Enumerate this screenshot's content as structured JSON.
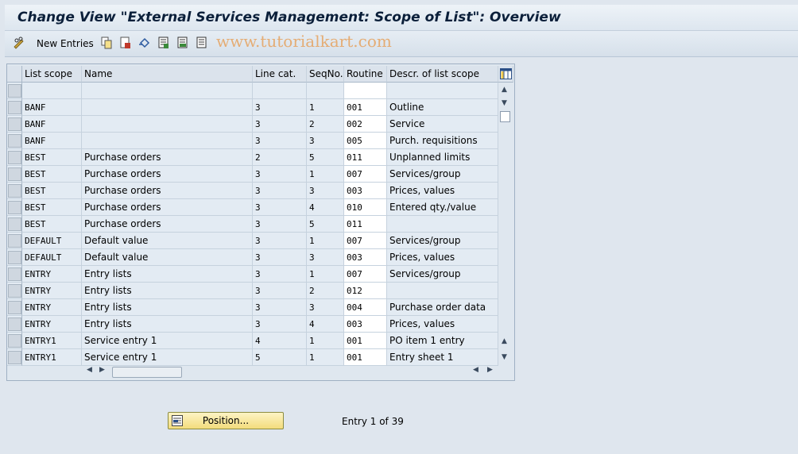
{
  "window": {
    "title": "Change View \"External Services Management: Scope of List\": Overview"
  },
  "toolbar": {
    "new_entries_label": "New Entries",
    "watermark": "www.tutorialkart.com",
    "icons": [
      "pencil-glasses-icon",
      "copy-icon",
      "delete-icon",
      "undo-icon",
      "select-all-icon",
      "select-block-icon",
      "deselect-all-icon"
    ]
  },
  "table": {
    "headers": {
      "list_scope": "List scope",
      "name": "Name",
      "line_cat": "Line cat.",
      "seq_no": "SeqNo.",
      "routine": "Routine",
      "descr": "Descr. of list scope"
    },
    "rows": [
      {
        "scope": "",
        "name": "",
        "line": "",
        "seq": "",
        "routine": "",
        "descr": ""
      },
      {
        "scope": "BANF",
        "name": "",
        "line": "3",
        "seq": "1",
        "routine": "001",
        "descr": "Outline"
      },
      {
        "scope": "BANF",
        "name": "",
        "line": "3",
        "seq": "2",
        "routine": "002",
        "descr": "Service"
      },
      {
        "scope": "BANF",
        "name": "",
        "line": "3",
        "seq": "3",
        "routine": "005",
        "descr": "Purch. requisitions"
      },
      {
        "scope": "BEST",
        "name": "Purchase orders",
        "line": "2",
        "seq": "5",
        "routine": "011",
        "descr": "Unplanned limits"
      },
      {
        "scope": "BEST",
        "name": "Purchase orders",
        "line": "3",
        "seq": "1",
        "routine": "007",
        "descr": "Services/group"
      },
      {
        "scope": "BEST",
        "name": "Purchase orders",
        "line": "3",
        "seq": "3",
        "routine": "003",
        "descr": "Prices, values"
      },
      {
        "scope": "BEST",
        "name": "Purchase orders",
        "line": "3",
        "seq": "4",
        "routine": "010",
        "descr": "Entered qty./value"
      },
      {
        "scope": "BEST",
        "name": "Purchase orders",
        "line": "3",
        "seq": "5",
        "routine": "011",
        "descr": ""
      },
      {
        "scope": "DEFAULT",
        "name": "Default value",
        "line": "3",
        "seq": "1",
        "routine": "007",
        "descr": "Services/group"
      },
      {
        "scope": "DEFAULT",
        "name": "Default value",
        "line": "3",
        "seq": "3",
        "routine": "003",
        "descr": "Prices, values"
      },
      {
        "scope": "ENTRY",
        "name": "Entry lists",
        "line": "3",
        "seq": "1",
        "routine": "007",
        "descr": "Services/group"
      },
      {
        "scope": "ENTRY",
        "name": "Entry lists",
        "line": "3",
        "seq": "2",
        "routine": "012",
        "descr": ""
      },
      {
        "scope": "ENTRY",
        "name": "Entry lists",
        "line": "3",
        "seq": "3",
        "routine": "004",
        "descr": "Purchase order data"
      },
      {
        "scope": "ENTRY",
        "name": "Entry lists",
        "line": "3",
        "seq": "4",
        "routine": "003",
        "descr": "Prices, values"
      },
      {
        "scope": "ENTRY1",
        "name": "Service entry 1",
        "line": "4",
        "seq": "1",
        "routine": "001",
        "descr": "PO item 1 entry"
      },
      {
        "scope": "ENTRY1",
        "name": "Service entry 1",
        "line": "5",
        "seq": "1",
        "routine": "001",
        "descr": "Entry sheet 1"
      }
    ]
  },
  "footer": {
    "position_label": "Position...",
    "entry_info": "Entry 1 of 39"
  },
  "colors": {
    "background": "#dfe6ee",
    "title_text": "#0b1f3a",
    "watermark": "#e6a360",
    "button_yellow": "#f3dc7c"
  }
}
